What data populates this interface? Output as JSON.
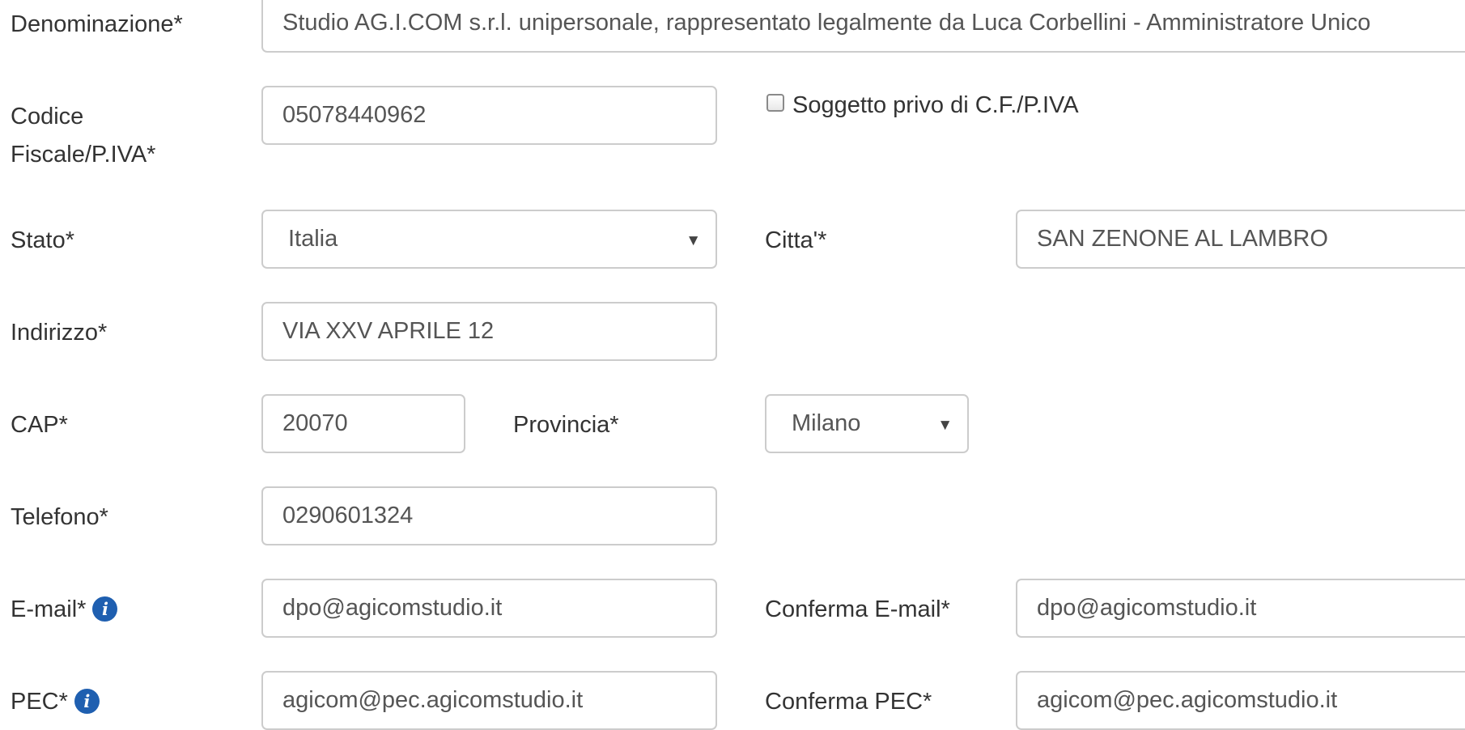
{
  "form": {
    "denominazione": {
      "label": "Denominazione*",
      "value": "Studio AG.I.COM s.r.l. unipersonale, rappresentato legalmente da Luca Corbellini - Amministratore Unico"
    },
    "codice_fiscale": {
      "label_line1": "Codice",
      "label_line2": "Fiscale/P.IVA*",
      "value": "05078440962"
    },
    "no_cf_checkbox": {
      "label": "Soggetto privo di C.F./P.IVA",
      "checked": false
    },
    "stato": {
      "label": "Stato*",
      "value": "Italia"
    },
    "citta": {
      "label": "Citta'*",
      "value": "SAN ZENONE AL LAMBRO"
    },
    "indirizzo": {
      "label": "Indirizzo*",
      "value": "VIA XXV APRILE 12"
    },
    "cap": {
      "label": "CAP*",
      "value": "20070"
    },
    "provincia": {
      "label": "Provincia*",
      "value": "Milano"
    },
    "telefono": {
      "label": "Telefono*",
      "value": "0290601324"
    },
    "email": {
      "label": "E-mail*",
      "value": "dpo@agicomstudio.it"
    },
    "conferma_email": {
      "label": "Conferma E-mail*",
      "value": "dpo@agicomstudio.it"
    },
    "pec": {
      "label": "PEC*",
      "value": "agicom@pec.agicomstudio.it"
    },
    "conferma_pec": {
      "label": "Conferma PEC*",
      "value": "agicom@pec.agicomstudio.it"
    }
  },
  "icons": {
    "info": "info-icon",
    "caret": "caret-down-icon"
  },
  "colors": {
    "info_icon": "#1f5fb0",
    "border": "#cccccc",
    "text": "#333333"
  }
}
